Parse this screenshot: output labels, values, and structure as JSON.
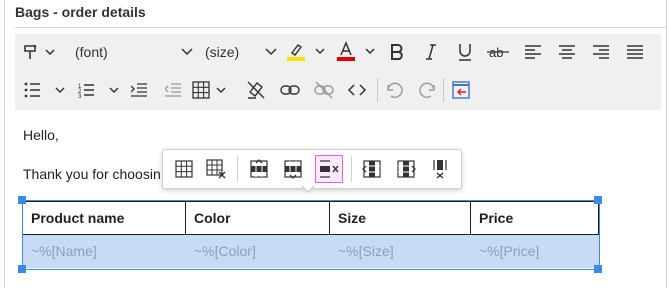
{
  "window": {
    "title": "Bags - order details"
  },
  "toolbar": {
    "font_select": "(font)",
    "size_select": "(size)",
    "colors": {
      "highlight": "#f5e400",
      "font_color": "#e00000"
    }
  },
  "body": {
    "greeting": "Hello,",
    "intro": "Thank you for choosin"
  },
  "table": {
    "headers": [
      "Product name",
      "Color",
      "Size",
      "Price"
    ],
    "row": [
      "~%[Name]",
      "~%[Color]",
      "~%[Size]",
      "~%[Price]"
    ]
  },
  "table_popup": {
    "buttons": [
      "table-properties-icon",
      "delete-table-icon",
      "insert-row-above-icon",
      "insert-row-below-icon",
      "delete-row-icon",
      "insert-column-left-icon",
      "insert-column-right-icon",
      "delete-column-icon"
    ],
    "active": "delete-row-icon"
  }
}
